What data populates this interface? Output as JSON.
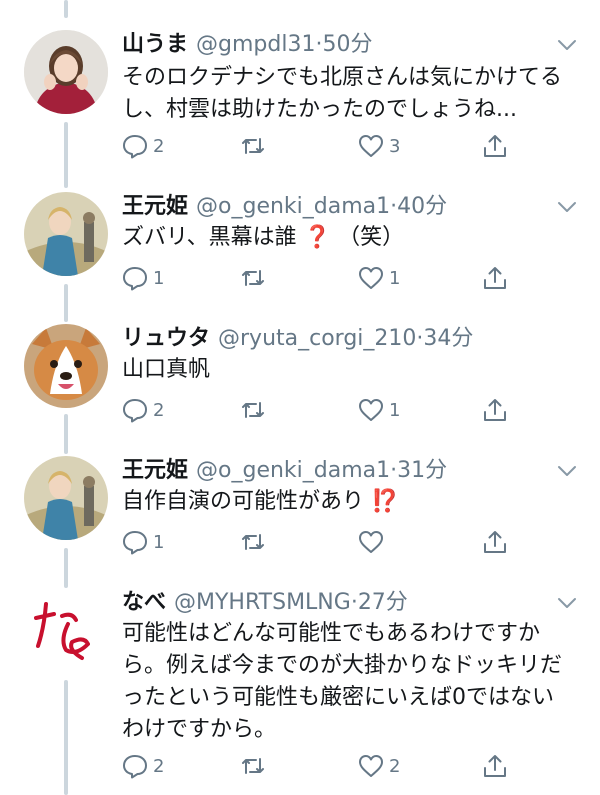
{
  "colors": {
    "secondary": "#657786",
    "thread": "#ccd6dd",
    "emoji_red": "#e0245e"
  },
  "tweets": [
    {
      "name": "山うま",
      "handle": "@gmpdl31",
      "sep": "·",
      "time": "50分",
      "lines": [
        "そのロクデナシでも北原さんは気にかけてる",
        "し、村雲は助けたかったのでしょうね..."
      ],
      "emoji": "",
      "reply_count": "2",
      "retweet_count": "",
      "like_count": "3",
      "avatar": "woman-red-sweater-photo"
    },
    {
      "name": "王元姫",
      "handle": "@o_genki_dama1",
      "sep": "·",
      "time": "40分",
      "lines": [
        "ズバリ、黒幕は誰"
      ],
      "emoji": "❓",
      "suffix": "（笑）",
      "reply_count": "1",
      "retweet_count": "",
      "like_count": "1",
      "avatar": "game-character-artwork"
    },
    {
      "name": "リュウタ",
      "handle": "@ryuta_corgi_210",
      "sep": "·",
      "time": "34分",
      "lines": [
        "山口真帆"
      ],
      "emoji": "",
      "reply_count": "2",
      "retweet_count": "",
      "like_count": "1",
      "avatar": "corgi-dog-photo"
    },
    {
      "name": "王元姫",
      "handle": "@o_genki_dama1",
      "sep": "·",
      "time": "31分",
      "lines": [
        "自作自演の可能性があり"
      ],
      "emoji": "⁉️",
      "reply_count": "1",
      "retweet_count": "",
      "like_count": "",
      "avatar": "game-character-artwork"
    },
    {
      "name": "なべ",
      "handle": "@MYHRTSMLNG",
      "sep": "·",
      "time": "27分",
      "lines": [
        "可能性はどんな可能性でもあるわけですか",
        "ら。例えば今までのが大掛かりなドッキリだ",
        "ったという可能性も厳密にいえば0ではない",
        "わけですから。"
      ],
      "emoji": "",
      "reply_count": "2",
      "retweet_count": "",
      "like_count": "2",
      "avatar": "handwritten-na-character",
      "avatar_text": "な"
    }
  ]
}
